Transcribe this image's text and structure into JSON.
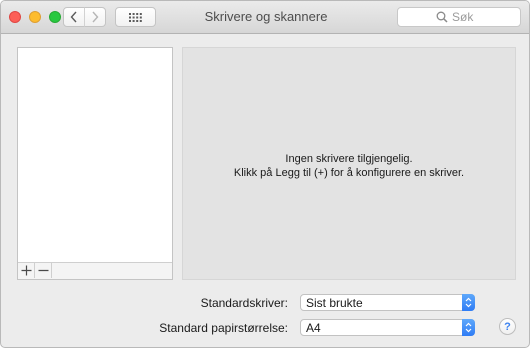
{
  "window": {
    "title": "Skrivere og skannere"
  },
  "toolbar": {
    "back_icon": "chevron-left-icon",
    "forward_icon": "chevron-right-icon",
    "grid_icon": "show-all-grid-icon"
  },
  "search": {
    "placeholder": "Søk",
    "icon": "search-icon"
  },
  "printer_list": {
    "items": [],
    "add_icon": "plus-icon",
    "remove_icon": "minus-icon"
  },
  "detail": {
    "empty_line1": "Ingen skrivere tilgjengelig.",
    "empty_line2": "Klikk på Legg til (+) for å konfigurere en skriver."
  },
  "settings": {
    "default_printer_label": "Standardskriver:",
    "default_printer_value": "Sist brukte",
    "paper_size_label": "Standard papirstørrelse:",
    "paper_size_value": "A4"
  },
  "help": {
    "label": "?"
  },
  "colors": {
    "accent": "#3b82f0",
    "close": "#fc5f57",
    "minimize": "#fdbc2e",
    "zoom": "#28c840"
  }
}
